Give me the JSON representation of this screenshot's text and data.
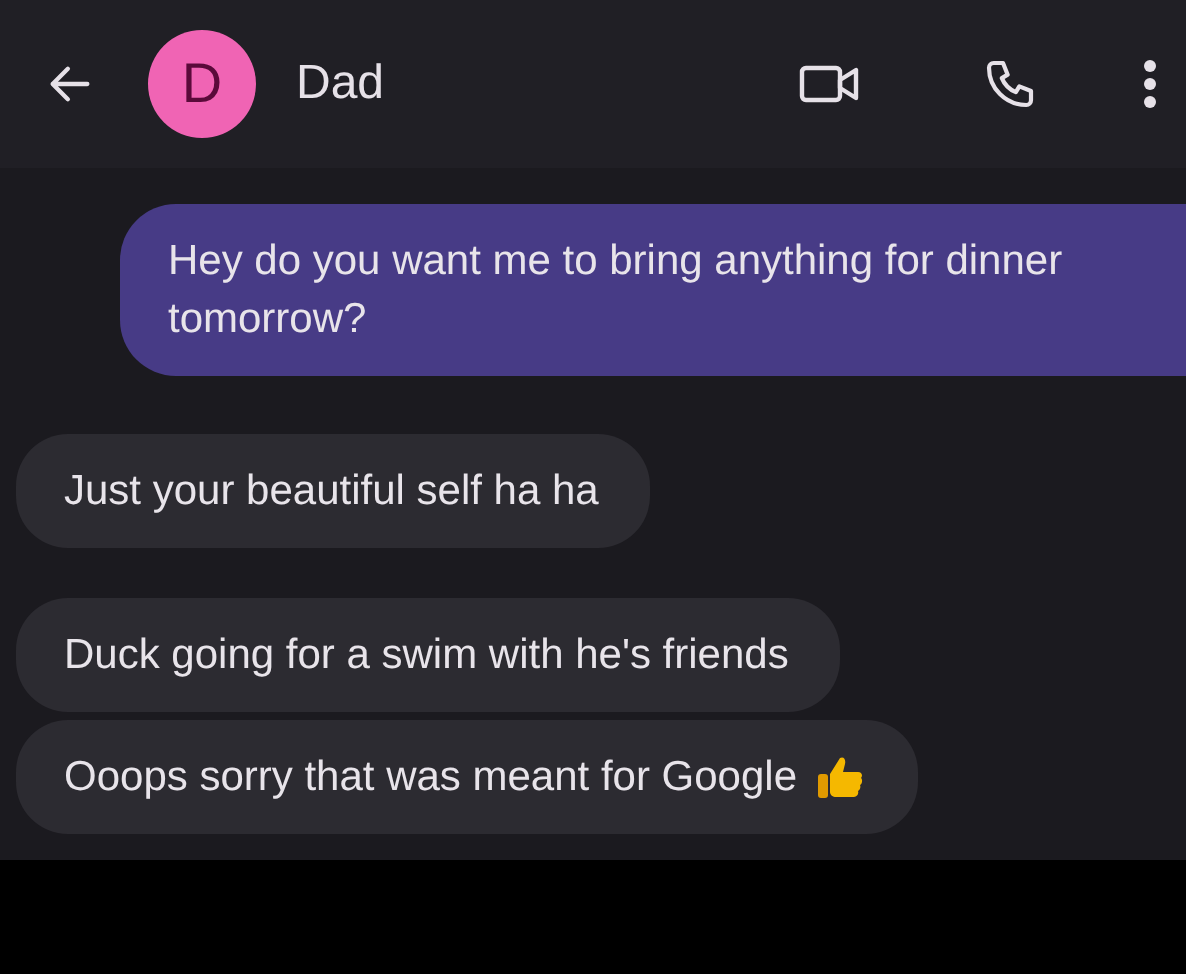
{
  "header": {
    "avatar_letter": "D",
    "contact_name": "Dad"
  },
  "messages": [
    {
      "kind": "sent",
      "text": "Hey do you want me to bring anything for dinner tomorrow?",
      "emoji": false
    },
    {
      "kind": "received",
      "text": "Just your beautiful self ha ha",
      "emoji": false
    },
    {
      "kind": "received",
      "text": "Duck going for a swim with he's friends",
      "emoji": false
    },
    {
      "kind": "received",
      "text": "Ooops sorry that was meant for Google",
      "emoji": true
    }
  ]
}
